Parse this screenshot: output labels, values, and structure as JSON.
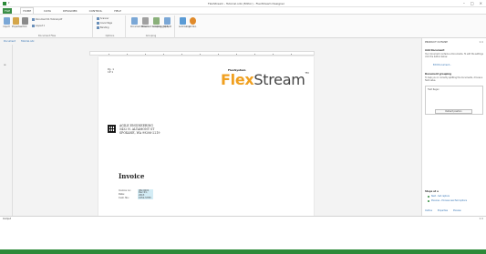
{
  "window": {
    "title": "FlexStream - Tutorial.odx (Editor) - FlexStream Designer",
    "controls": [
      "–",
      "□",
      "×"
    ]
  },
  "ribbon": {
    "tabs": [
      "FILE",
      "HOME",
      "DATA",
      "DESIGNER",
      "CONTROL",
      "HELP"
    ],
    "active_tab": "HOME",
    "groups": {
      "document": {
        "label": "Document Files",
        "buttons": [
          "Import",
          "Properties",
          "Print"
        ],
        "small": [
          "Document 01 Tutorial.pdf",
          "Layout 1"
        ]
      },
      "options": {
        "label": "Options",
        "small": [
          "Scanner",
          "Cover Page",
          "Banding"
        ]
      },
      "grouping": {
        "label": "Grouping",
        "buttons": [
          "Document Wizard",
          "Document Grouping",
          "Combining Split",
          "Job Split"
        ]
      },
      "extra": {
        "buttons": [
          "Automation",
          "Job Run"
        ]
      }
    }
  },
  "doc_tabs": [
    "Document",
    "Tutorial.odx"
  ],
  "gutter_markers": [
    "≡"
  ],
  "page": {
    "page_label": "Pg. 1",
    "page_sub": "1P 1",
    "logo_small": "FlexSystem",
    "logo_flex": "Flex",
    "logo_stream": "Stream",
    "logo_tm": "TM",
    "address": [
      "AGILE ENGINEERING",
      "5432 N. ALTAMONT ST",
      "SPOKANE, WA 99206-2219"
    ],
    "invoice_title": "Invoice",
    "invoice_rows": [
      {
        "key": "Invoice no:",
        "value": "INV-0001"
      },
      {
        "key": "Date:",
        "value": "Dec 01, 2013"
      },
      {
        "key": "Cust. No.:",
        "value": "1052-5783"
      }
    ]
  },
  "right_pane": {
    "title": "PRODUCT OUTLINE",
    "section1": "Add Document",
    "text1": "Your document contains a Documents. To edit the settings click the button below.",
    "link1": "Edit Document...",
    "section2": "Document grouping",
    "text2": "To help you in correctly splitting the documents, choose a field value.",
    "box_label": "Field Regex",
    "default_button": "Default position",
    "section3": "Steps at a",
    "options": [
      "Next - Set capture",
      "Previous - Process new field options"
    ],
    "footer": [
      "Outline",
      "Properties",
      "Preview"
    ]
  },
  "bottom": {
    "title": "Output",
    "ctrl": "▾ ✕"
  }
}
